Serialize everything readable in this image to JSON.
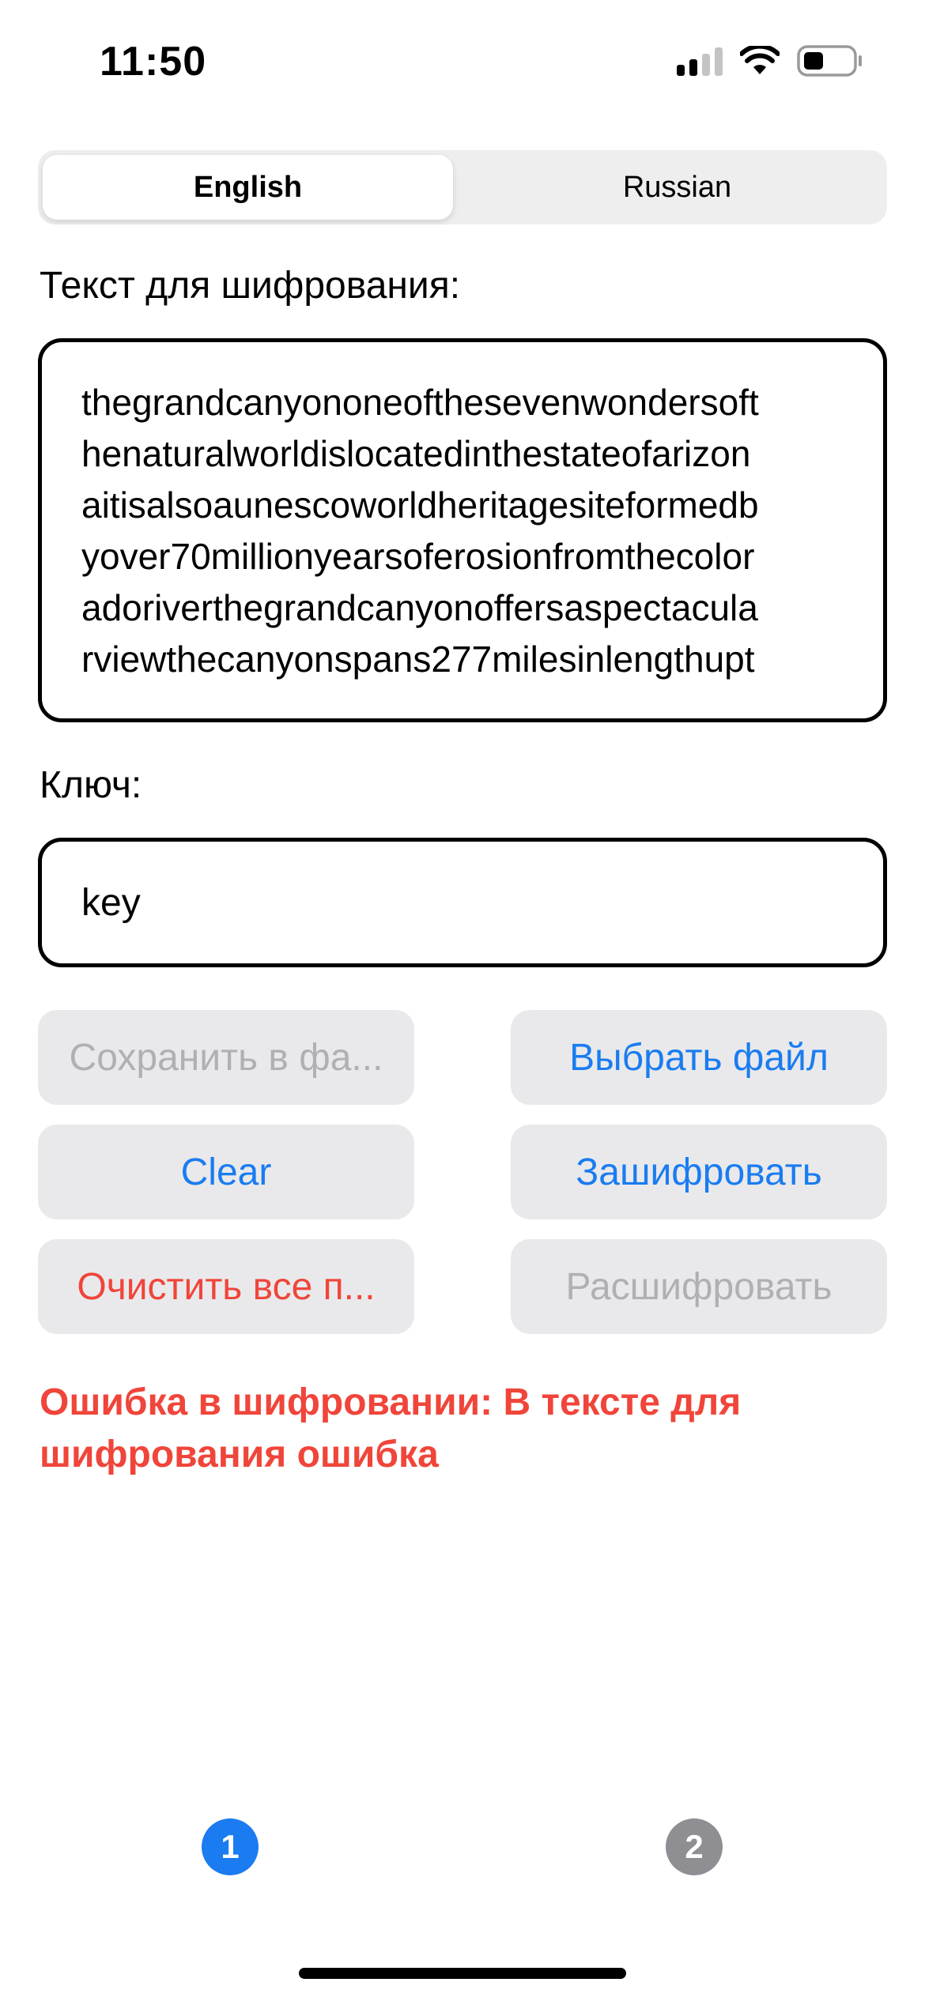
{
  "status_bar": {
    "time": "11:50",
    "icons": [
      "cellular-signal-icon",
      "wifi-icon",
      "battery-icon"
    ]
  },
  "segmented": {
    "options": [
      "English",
      "Russian"
    ],
    "selected": "English"
  },
  "text_field": {
    "label": "Текст для шифрования:",
    "lines": [
      "thegrandcanyononeofthesevenwondersoft",
      "henaturalworldislocatedinthestateofarizon",
      "aitisalsoaunescoworldheritagesiteformedb",
      "yover70millionyearsoferosionfromthecolor",
      "adoriverthegrandcanyonoffersaspectacula",
      "rviewthecanyonspans277milesinlengthupt"
    ]
  },
  "key_field": {
    "label": "Ключ:",
    "value": "key"
  },
  "buttons": {
    "save": "Сохранить в фа...",
    "choose_file": "Выбрать файл",
    "clear": "Clear",
    "encrypt": "Зашифровать",
    "clear_all": "Очистить все п...",
    "decrypt": "Расшифровать"
  },
  "error": {
    "message": "Ошибка в шифровании: В тексте для шифрования ошибка"
  },
  "pager": {
    "pages": [
      "1",
      "2"
    ],
    "active": "1"
  },
  "colors": {
    "accent_blue": "#1a7cf0",
    "destructive_red": "#f0453a",
    "disabled_gray": "#b0b0b4",
    "button_bg": "#e9e9eb",
    "pager_active": "#1a7cf0",
    "pager_inactive": "#8e8e93"
  }
}
